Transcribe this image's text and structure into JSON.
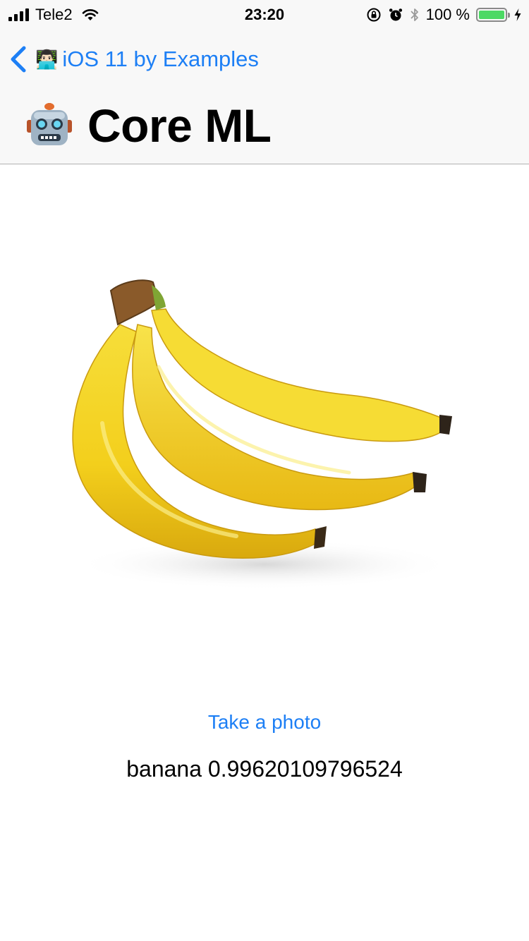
{
  "status_bar": {
    "carrier": "Tele2",
    "time": "23:20",
    "battery_percent": "100 %",
    "battery_level": 1.0,
    "icons": [
      "signal-bars-icon",
      "wifi-icon",
      "rotation-lock-icon",
      "alarm-icon",
      "bluetooth-icon",
      "battery-icon",
      "charging-bolt-icon"
    ]
  },
  "nav": {
    "back_emoji": "👨🏻‍💻",
    "back_label": "iOS 11 by Examples",
    "title_emoji_icon": "robot-face-icon",
    "title": "Core ML"
  },
  "content": {
    "image_subject": "bananas-photo",
    "take_photo_label": "Take a photo",
    "result": "banana 0.99620109796524"
  },
  "colors": {
    "accent": "#1d7ff5",
    "nav_background": "#f8f8f8",
    "battery_fill": "#4cd964"
  }
}
